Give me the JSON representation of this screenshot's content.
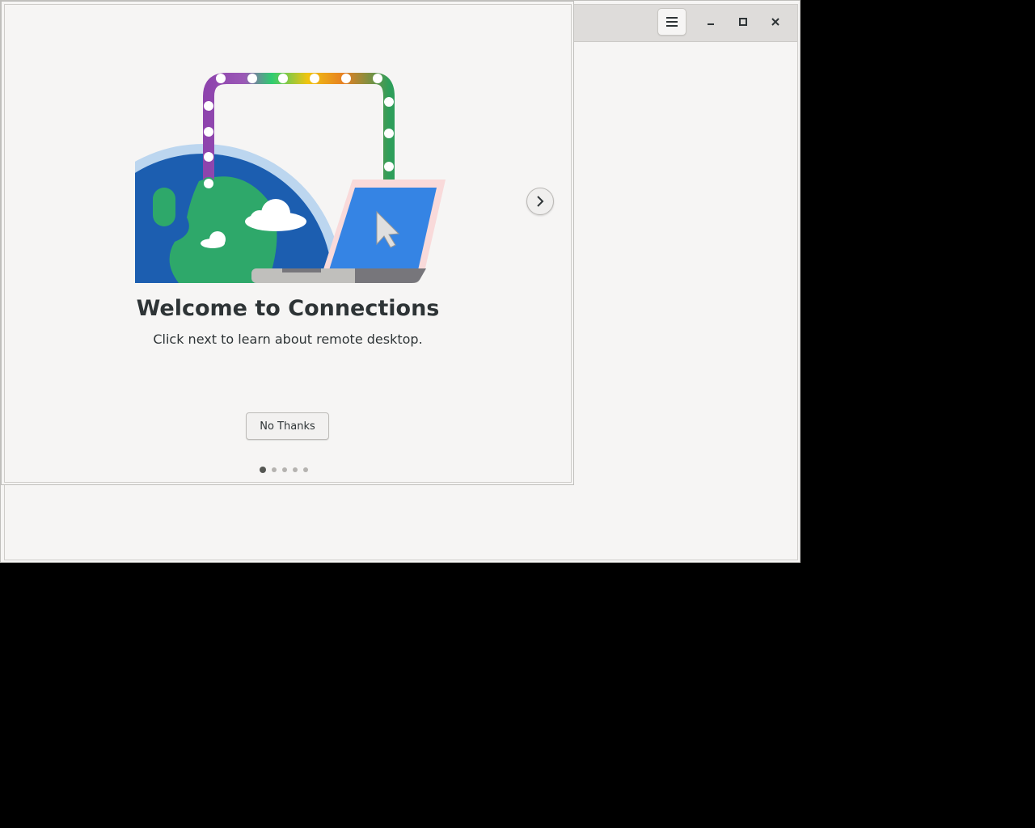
{
  "window": {
    "headerbar": {
      "menu_icon": "hamburger-menu-icon",
      "minimize_icon": "minimize-icon",
      "maximize_icon": "maximize-icon",
      "close_icon": "close-icon"
    }
  },
  "onboarding": {
    "title": "Welcome to Connections",
    "subtitle": "Click next to learn about remote desktop.",
    "dismiss_label": "No Thanks",
    "next_icon": "chevron-right-icon",
    "pages_total": 5,
    "current_page": 1
  },
  "colors": {
    "window_bg": "#f6f5f4",
    "headerbar_bg": "#dedcda",
    "text": "#2e3436",
    "globe_blue": "#1c5eb0",
    "land_green": "#2ea86a",
    "laptop_screen": "#3584e4",
    "laptop_outline": "#f9dada",
    "desktop_bg": "#000000"
  }
}
